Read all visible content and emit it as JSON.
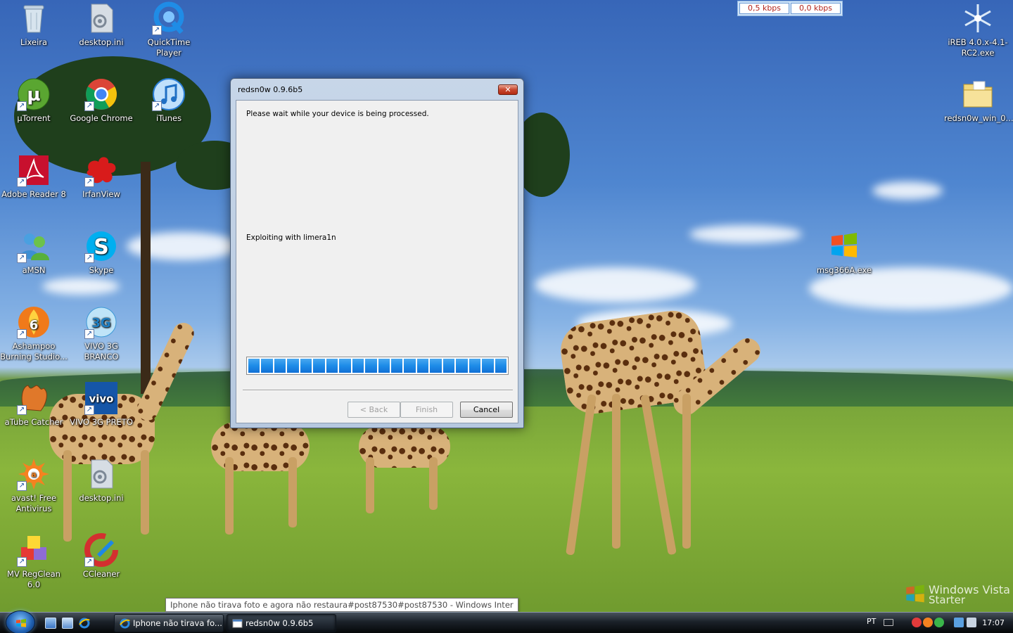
{
  "desktop": {
    "icons": [
      {
        "label": "Lixeira",
        "icon": "recycle-bin-icon"
      },
      {
        "label": "desktop.ini",
        "icon": "settings-file-icon"
      },
      {
        "label": "QuickTime Player",
        "icon": "quicktime-icon"
      },
      {
        "label": "µTorrent",
        "icon": "utorrent-icon"
      },
      {
        "label": "Google Chrome",
        "icon": "chrome-icon"
      },
      {
        "label": "iTunes",
        "icon": "itunes-icon"
      },
      {
        "label": "Adobe Reader 8",
        "icon": "adobe-reader-icon"
      },
      {
        "label": "IrfanView",
        "icon": "irfanview-icon"
      },
      {
        "label": "aMSN",
        "icon": "amsn-icon"
      },
      {
        "label": "Skype",
        "icon": "skype-icon"
      },
      {
        "label": "Ashampoo Burning Studio...",
        "icon": "ashampoo-icon"
      },
      {
        "label": "VIVO 3G BRANCO",
        "icon": "vivo-white-icon"
      },
      {
        "label": "aTube Catcher",
        "icon": "atube-icon"
      },
      {
        "label": "VIVO 3G PRETO",
        "icon": "vivo-black-icon"
      },
      {
        "label": "avast! Free Antivirus",
        "icon": "avast-icon"
      },
      {
        "label": "desktop.ini",
        "icon": "settings-file-icon"
      },
      {
        "label": "MV RegClean 6.0",
        "icon": "regclean-icon"
      },
      {
        "label": "CCleaner",
        "icon": "ccleaner-icon"
      },
      {
        "label": "iREB 4.0.x-4.1-RC2.exe",
        "icon": "ireb-icon"
      },
      {
        "label": "redsn0w_win_0....",
        "icon": "folder-icon"
      },
      {
        "label": "msg366A.exe",
        "icon": "windows-logo-icon"
      }
    ]
  },
  "netmeter": {
    "down": "0,5 kbps",
    "up": "0,0 kbps"
  },
  "dialog": {
    "title": "redsn0w 0.9.6b5",
    "message": "Please wait while your device is being processed.",
    "status": "Exploiting with limera1n",
    "progress": 1.0,
    "buttons": {
      "back": "< Back",
      "finish": "Finish",
      "cancel": "Cancel"
    }
  },
  "tooltip": "Iphone não tirava foto e agora não restaura#post87530#post87530 - Windows Inter",
  "branding": {
    "line1": "Windows Vista",
    "line2": "Starter"
  },
  "taskbar": {
    "tasks": [
      {
        "label": "Iphone não tirava fo...",
        "icon": "internet-explorer-icon"
      },
      {
        "label": "redsn0w 0.9.6b5",
        "icon": "app-window-icon"
      }
    ],
    "tray": {
      "language": "PT",
      "time": "17:07"
    }
  }
}
